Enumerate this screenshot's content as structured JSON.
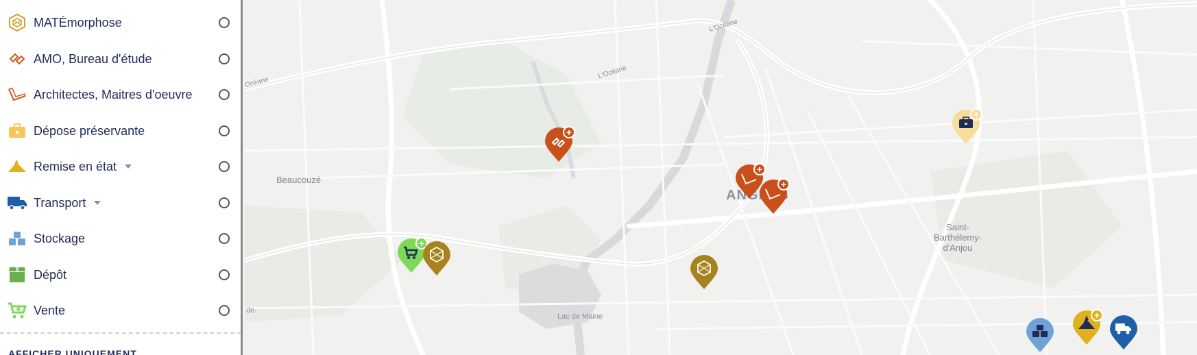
{
  "sidebar": {
    "items": [
      {
        "label": "MATÉmorphose",
        "icon": "hexagon-logo-icon",
        "color": "#d99a2b",
        "has_caret": false
      },
      {
        "label": "AMO, Bureau d'étude",
        "icon": "blueprint-link-icon",
        "color": "#d2551a",
        "has_caret": false
      },
      {
        "label": "Architectes, Maitres d'oeuvre",
        "icon": "ruler-drafting-icon",
        "color": "#d2551a",
        "has_caret": false
      },
      {
        "label": "Dépose préservante",
        "icon": "toolbox-icon",
        "color": "#f6c75c",
        "has_caret": false
      },
      {
        "label": "Remise en état",
        "icon": "trowel-icon",
        "color": "#e0b01e",
        "has_caret": true
      },
      {
        "label": "Transport",
        "icon": "truck-icon",
        "color": "#1f5fa8",
        "has_caret": true
      },
      {
        "label": "Stockage",
        "icon": "stacked-boxes-icon",
        "color": "#6fa3d8",
        "has_caret": false
      },
      {
        "label": "Dépôt",
        "icon": "package-icon",
        "color": "#6ab04c",
        "has_caret": false
      },
      {
        "label": "Vente",
        "icon": "cart-plus-icon",
        "color": "#7ed957",
        "has_caret": false
      }
    ],
    "bottom_text": "AFFICHER UNIQUEMENT"
  },
  "map": {
    "places": {
      "beaucouze": "Beaucouzé",
      "angers": "ANGERS",
      "saint_barthelemy_1": "Saint-",
      "saint_barthelemy_2": "Barthélemy-",
      "saint_barthelemy_3": "d'Anjou",
      "lac_de_maine": "Lac de Maine",
      "oceane_1": "L'Océane",
      "oceane_2": "L'Océane",
      "oceane_3": "Océane",
      "edge_de": "de-"
    },
    "pins": [
      {
        "icon": "blueprint-link-icon",
        "color": "#c9501a",
        "badge": "+"
      },
      {
        "icon": "ruler-drafting-icon",
        "color": "#c9501a",
        "badge": "+"
      },
      {
        "icon": "ruler-drafting-icon",
        "color": "#c9501a",
        "badge": "+"
      },
      {
        "icon": "toolbox-icon",
        "color": "#f7dc9a",
        "badge": "+"
      },
      {
        "icon": "cart-plus-icon",
        "color": "#7ed957",
        "badge": "+"
      },
      {
        "icon": "hexagon-logo-icon",
        "color": "#a8821d",
        "badge": ""
      },
      {
        "icon": "hexagon-logo-icon",
        "color": "#a8821d",
        "badge": ""
      },
      {
        "icon": "stacked-boxes-icon",
        "color": "#6fa3d8",
        "badge": ""
      },
      {
        "icon": "trowel-icon",
        "color": "#e0b01e",
        "badge": "+"
      },
      {
        "icon": "truck-icon",
        "color": "#1f5fa8",
        "badge": ""
      }
    ]
  }
}
